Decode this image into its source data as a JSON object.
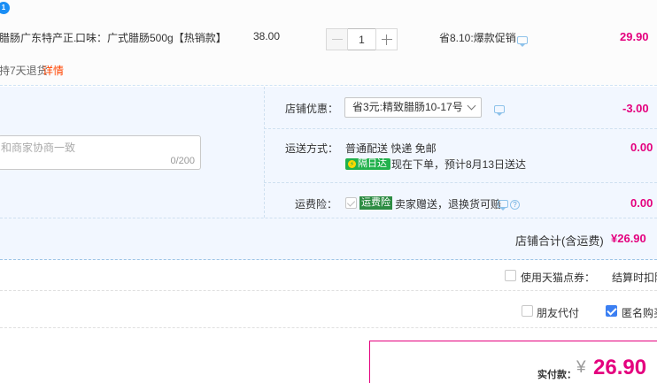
{
  "product": {
    "badge": "1",
    "title": "腊肠广东特产正...",
    "spec": "口味：广式腊肠500g【热销款】",
    "unit_price": "38.00",
    "quantity": "1",
    "promo": "省8.10:爆款促销",
    "subtotal": "29.90",
    "service": "持7天退货",
    "service_link": "详情"
  },
  "memo": {
    "placeholder": "和商家协商一致",
    "count": "0/200"
  },
  "shop": {
    "coupon_label": "店铺优惠：",
    "coupon_value": "省3元:精致腊肠10-17号",
    "coupon_amount": "-3.00",
    "shipping_label": "运送方式：",
    "shipping_method": "普通配送 快递 免邮",
    "next_day_tag": "隔日达",
    "shipping_eta": "现在下单，预计8月13日送达",
    "shipping_amount": "0.00",
    "insurance_label": "运费险：",
    "insurance_tag": "运费险",
    "insurance_desc": "卖家赠送，退换货可赔",
    "insurance_amount": "0.00",
    "total_label": "店铺合计(含运费)",
    "total_value": "¥26.90"
  },
  "options": {
    "tmall_points_label": "使用天猫点券：",
    "settle_note": "结算时扣除",
    "friend_pay_label": "朋友代付",
    "anonymous_label": "匿名购买"
  },
  "payment": {
    "label": "实付款：",
    "currency": "¥",
    "amount": "26.90"
  }
}
